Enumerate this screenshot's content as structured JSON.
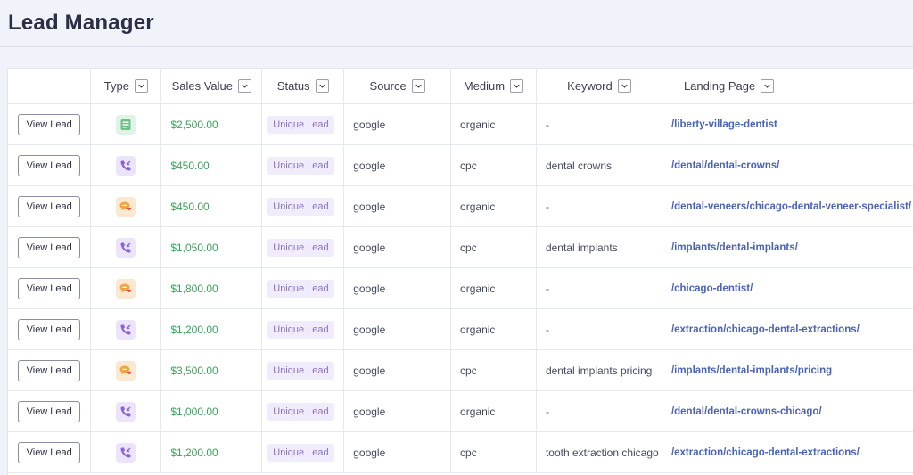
{
  "page": {
    "title": "Lead Manager"
  },
  "table": {
    "headers": {
      "type": "Type",
      "sales_value": "Sales Value",
      "status": "Status",
      "source": "Source",
      "medium": "Medium",
      "keyword": "Keyword",
      "landing_page": "Landing Page"
    },
    "rows": [
      {
        "button": "View Lead",
        "type": "form-icon",
        "sales_value": "$2,500.00",
        "status": "Unique Lead",
        "source": "google",
        "medium": "organic",
        "keyword": "-",
        "landing_page": "/liberty-village-dentist"
      },
      {
        "button": "View Lead",
        "type": "call-icon",
        "sales_value": "$450.00",
        "status": "Unique Lead",
        "source": "google",
        "medium": "cpc",
        "keyword": "dental crowns",
        "landing_page": "/dental/dental-crowns/"
      },
      {
        "button": "View Lead",
        "type": "chat-icon",
        "sales_value": "$450.00",
        "status": "Unique Lead",
        "source": "google",
        "medium": "organic",
        "keyword": "-",
        "landing_page": "/dental-veneers/chicago-dental-veneer-specialist/"
      },
      {
        "button": "View Lead",
        "type": "call-icon",
        "sales_value": "$1,050.00",
        "status": "Unique Lead",
        "source": "google",
        "medium": "cpc",
        "keyword": "dental implants",
        "landing_page": "/implants/dental-implants/"
      },
      {
        "button": "View Lead",
        "type": "chat-icon",
        "sales_value": "$1,800.00",
        "status": "Unique Lead",
        "source": "google",
        "medium": "organic",
        "keyword": "-",
        "landing_page": "/chicago-dentist/"
      },
      {
        "button": "View Lead",
        "type": "call-icon",
        "sales_value": "$1,200.00",
        "status": "Unique Lead",
        "source": "google",
        "medium": "organic",
        "keyword": "-",
        "landing_page": "/extraction/chicago-dental-extractions/"
      },
      {
        "button": "View Lead",
        "type": "chat-icon",
        "sales_value": "$3,500.00",
        "status": "Unique Lead",
        "source": "google",
        "medium": "cpc",
        "keyword": "dental implants pricing",
        "landing_page": "/implants/dental-implants/pricing"
      },
      {
        "button": "View Lead",
        "type": "call-icon",
        "sales_value": "$1,000.00",
        "status": "Unique Lead",
        "source": "google",
        "medium": "organic",
        "keyword": "-",
        "landing_page": "/dental/dental-crowns-chicago/"
      },
      {
        "button": "View Lead",
        "type": "call-icon",
        "sales_value": "$1,200.00",
        "status": "Unique Lead",
        "source": "google",
        "medium": "cpc",
        "keyword": "tooth extraction chicago",
        "landing_page": "/extraction/chicago-dental-extractions/"
      }
    ]
  },
  "colors": {
    "sales_value": "#3aa35c",
    "status_badge_bg": "#f1ecfb",
    "status_badge_text": "#8a6fbf",
    "link": "#4a63b8"
  }
}
